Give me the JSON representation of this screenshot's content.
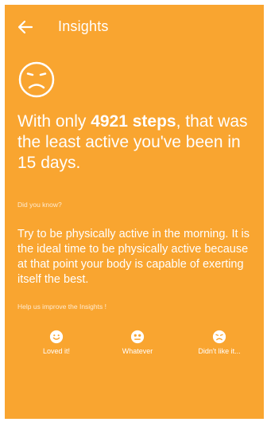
{
  "colors": {
    "accent": "#F9A530",
    "text": "#FFFFFF"
  },
  "appbar": {
    "title": "Insights",
    "back_icon": "arrow-left-icon"
  },
  "insight": {
    "icon": "sad-face-icon",
    "prefix": "With only ",
    "highlight": "4921 steps",
    "suffix": ", that was the least active you've been in 15 days."
  },
  "did_you_know": {
    "label": "Did you know?",
    "tip": "Try to be physically active in the morning. It is the ideal time to be physically active because at that point your body is capable of exerting itself the best."
  },
  "feedback": {
    "prompt": "Help us improve the Insights !",
    "options": [
      {
        "label": "Loved it!",
        "icon": "happy-face-icon"
      },
      {
        "label": "Whatever",
        "icon": "neutral-face-icon"
      },
      {
        "label": "Didn't like it...",
        "icon": "sad-face-icon"
      }
    ]
  }
}
